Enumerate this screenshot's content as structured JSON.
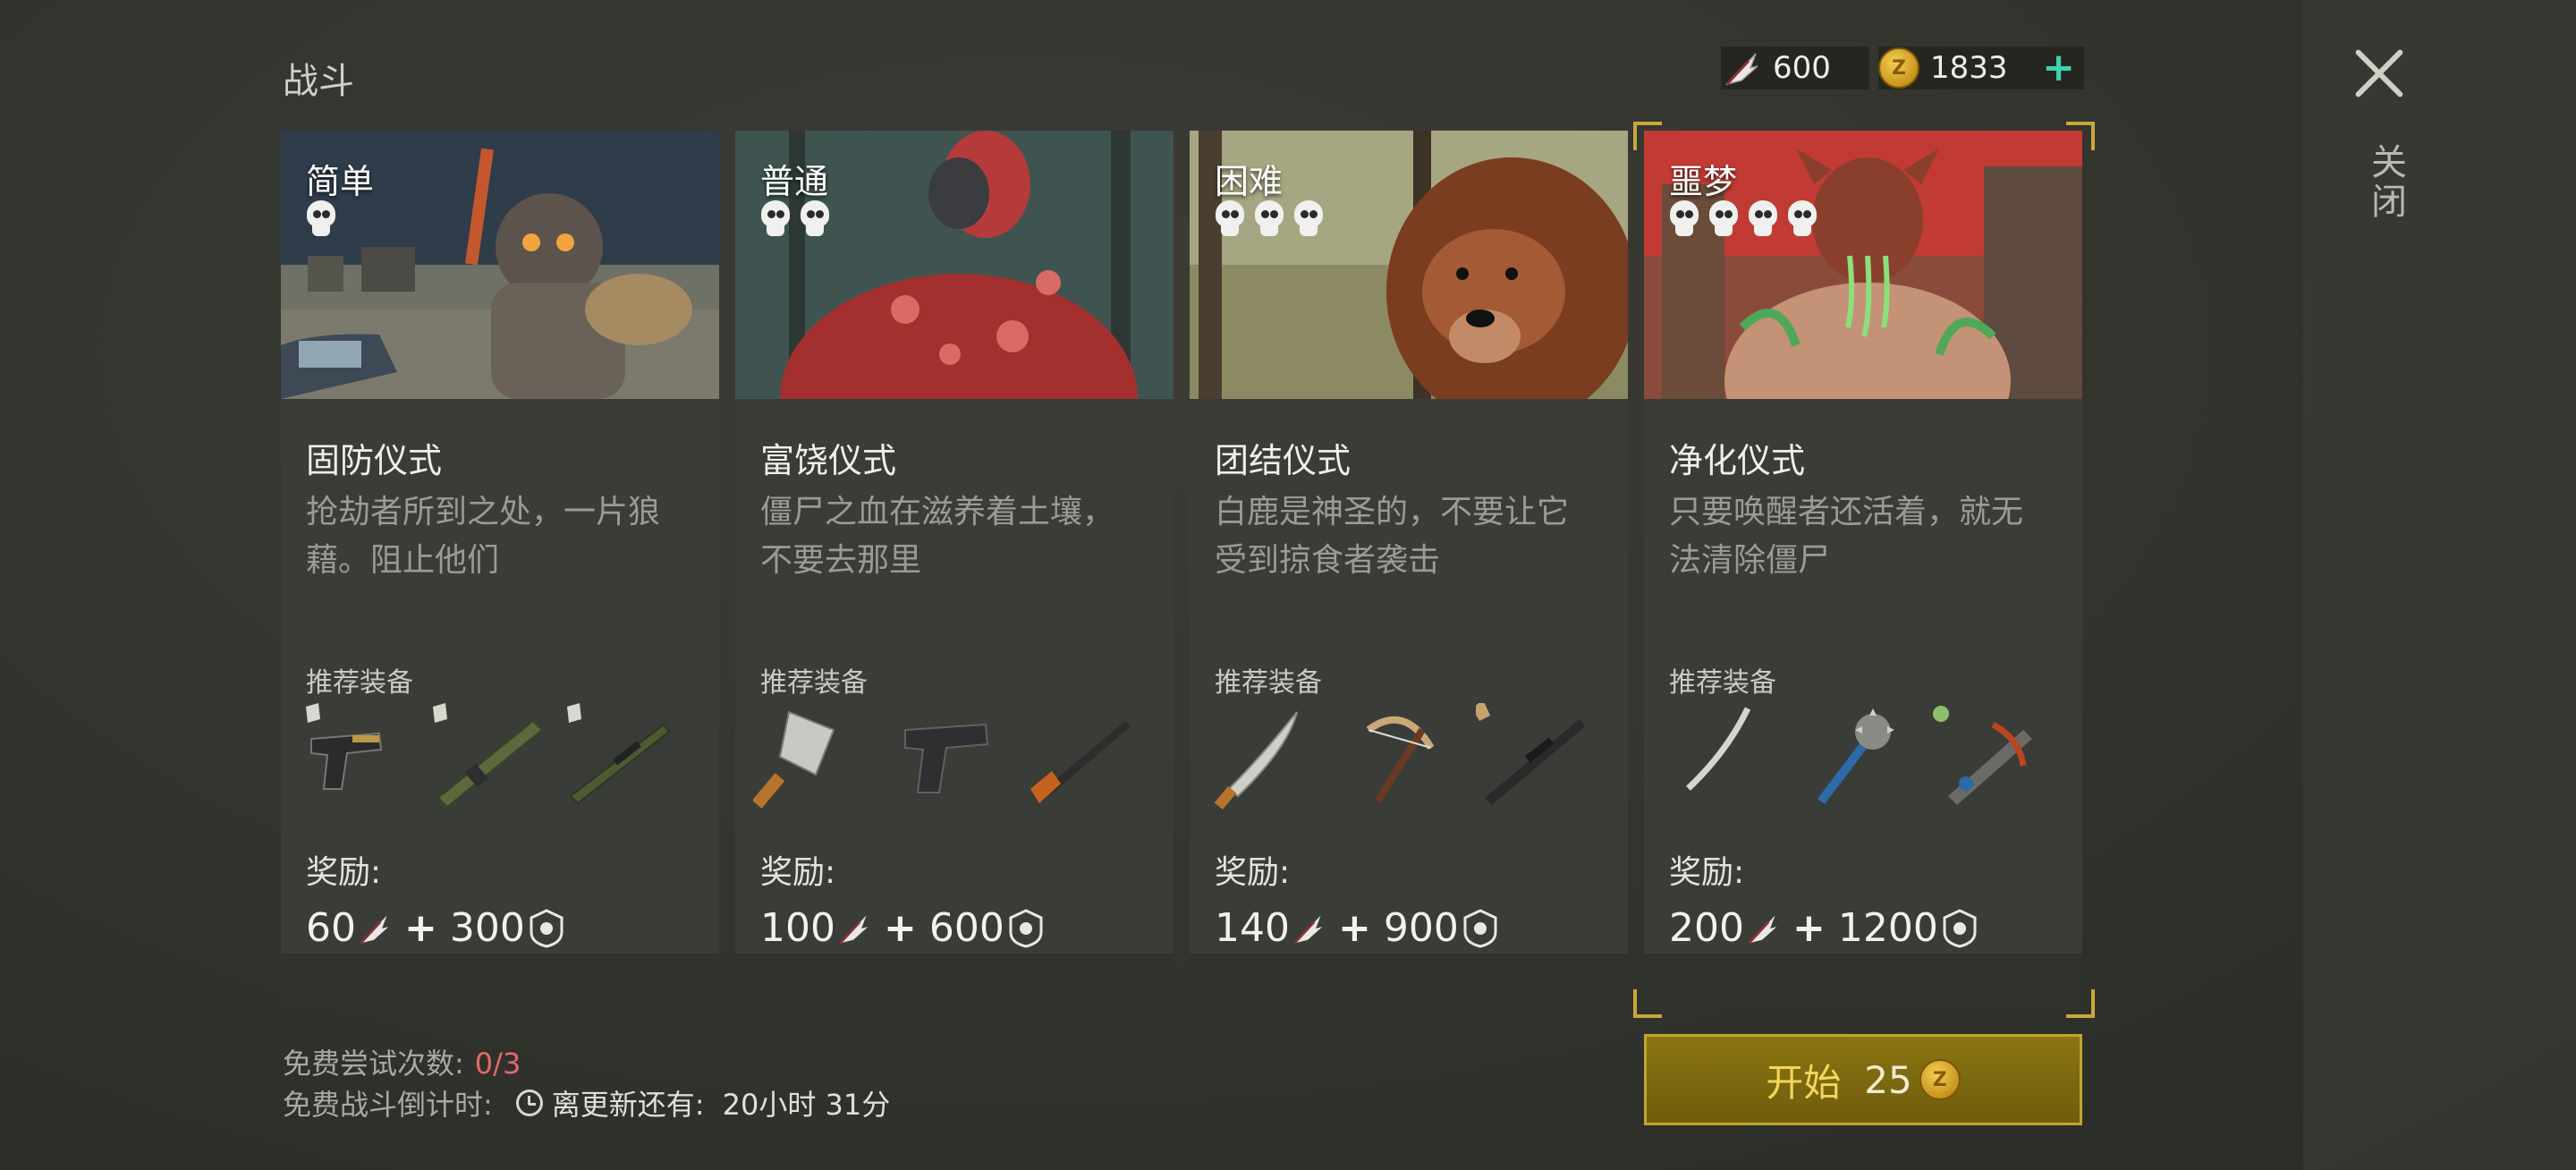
{
  "header": {
    "title": "战斗"
  },
  "currency": {
    "feathers": "600",
    "coins": "1833"
  },
  "close": {
    "label": "关闭"
  },
  "cards": [
    {
      "difficulty": "简单",
      "skulls": 1,
      "name": "固防仪式",
      "desc": "抢劫者所到之处，一片狼藉。阻止他们",
      "rec_label": "推荐装备",
      "reward_label": "奖励:",
      "reward_feathers": "60",
      "reward_points": "300"
    },
    {
      "difficulty": "普通",
      "skulls": 2,
      "name": "富饶仪式",
      "desc": "僵尸之血在滋养着土壤，不要去那里",
      "rec_label": "推荐装备",
      "reward_label": "奖励:",
      "reward_feathers": "100",
      "reward_points": "600"
    },
    {
      "difficulty": "困难",
      "skulls": 3,
      "name": "团结仪式",
      "desc": "白鹿是神圣的，不要让它受到掠食者袭击",
      "rec_label": "推荐装备",
      "reward_label": "奖励:",
      "reward_feathers": "140",
      "reward_points": "900"
    },
    {
      "difficulty": "噩梦",
      "skulls": 4,
      "name": "净化仪式",
      "desc": "只要唤醒者还活着，就无法清除僵尸",
      "rec_label": "推荐装备",
      "reward_label": "奖励:",
      "reward_feathers": "200",
      "reward_points": "1200"
    }
  ],
  "footer": {
    "free_tries_label": "免费尝试次数:",
    "free_tries_value": "0/3",
    "countdown_label": "免费战斗倒计时:",
    "refresh_label": "离更新还有:",
    "refresh_time": "20小时 31分"
  },
  "start_button": {
    "label": "开始",
    "cost": "25"
  },
  "colors": {
    "accent_gold": "#c9a83a",
    "plus_teal": "#3dd2b2",
    "tries_red": "#e06a6a"
  }
}
